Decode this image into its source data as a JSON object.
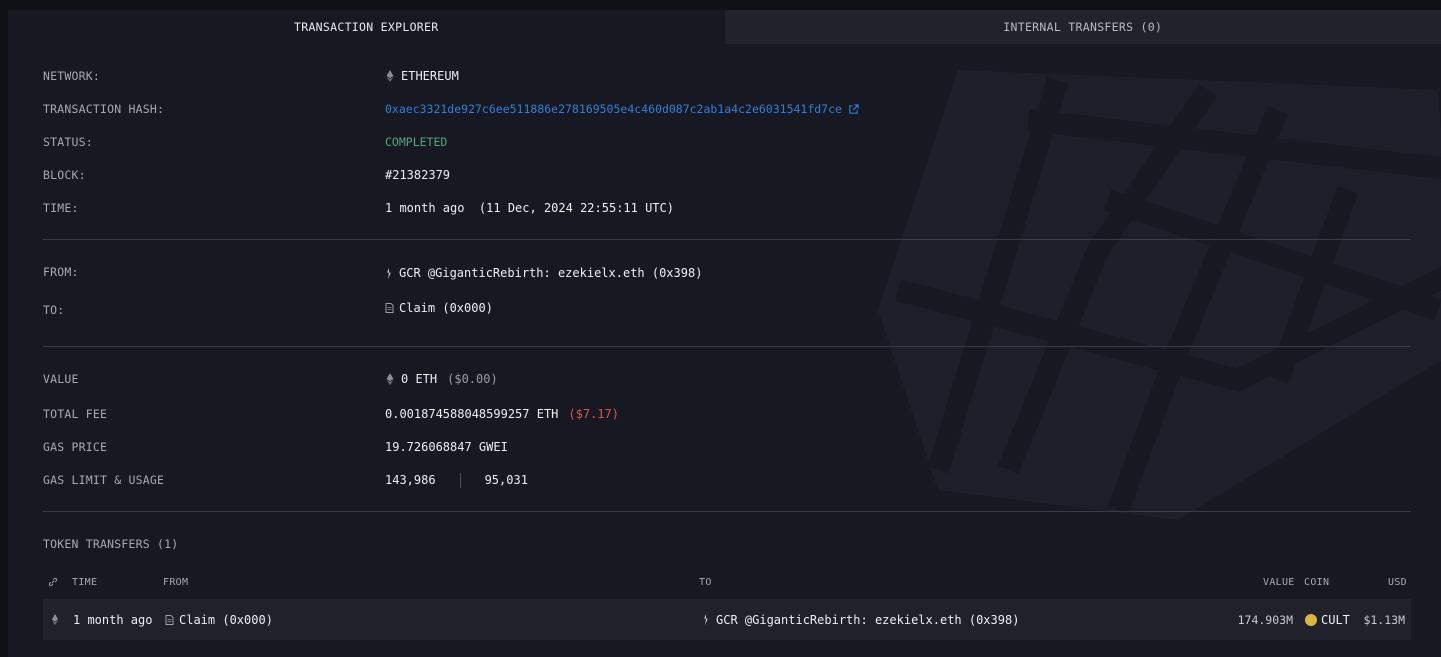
{
  "tabs": [
    {
      "label": "TRANSACTION EXPLORER",
      "active": true
    },
    {
      "label": "INTERNAL TRANSFERS (0)",
      "active": false
    }
  ],
  "details": {
    "network": {
      "label": "NETWORK:",
      "value": "ETHEREUM"
    },
    "hash": {
      "label": "TRANSACTION HASH:",
      "value": "0xaec3321de927c6ee511886e278169505e4c460d087c2ab1a4c2e6031541fd7ce"
    },
    "status": {
      "label": "STATUS:",
      "value": "COMPLETED"
    },
    "block": {
      "label": "BLOCK:",
      "value": "#21382379"
    },
    "time": {
      "label": "TIME:",
      "value": "1 month ago  (11 Dec, 2024 22:55:11 UTC)"
    },
    "from": {
      "label": "FROM:",
      "value": "GCR @GiganticRebirth: ezekielx.eth (0x398)"
    },
    "to": {
      "label": "TO:",
      "value": "Claim (0x000)"
    },
    "value": {
      "label": "VALUE",
      "value": "0 ETH",
      "usd": "($0.00)"
    },
    "fee": {
      "label": "TOTAL FEE",
      "value": "0.001874588048599257 ETH",
      "usd": "($7.17)"
    },
    "gas_price": {
      "label": "GAS PRICE",
      "value": "19.726068847 GWEI"
    },
    "gas_limit": {
      "label": "GAS LIMIT & USAGE",
      "limit": "143,986",
      "usage": "95,031"
    }
  },
  "token_transfers": {
    "title": "TOKEN TRANSFERS (1)",
    "columns": {
      "time": "TIME",
      "from": "FROM",
      "to": "TO",
      "value": "VALUE",
      "coin": "COIN",
      "usd": "USD"
    },
    "rows": [
      {
        "time": "1 month ago",
        "from": "Claim (0x000)",
        "to": "GCR @GiganticRebirth: ezekielx.eth (0x398)",
        "value": "174.903M",
        "coin": "CULT",
        "usd": "$1.13M"
      }
    ]
  },
  "colors": {
    "accent": "#2f7fd6",
    "success": "#53a878",
    "danger": "#d0594f"
  },
  "icons": [
    "ethereum-icon",
    "external-link-icon",
    "user-icon",
    "document-icon",
    "link-icon",
    "cult-coin-icon"
  ]
}
